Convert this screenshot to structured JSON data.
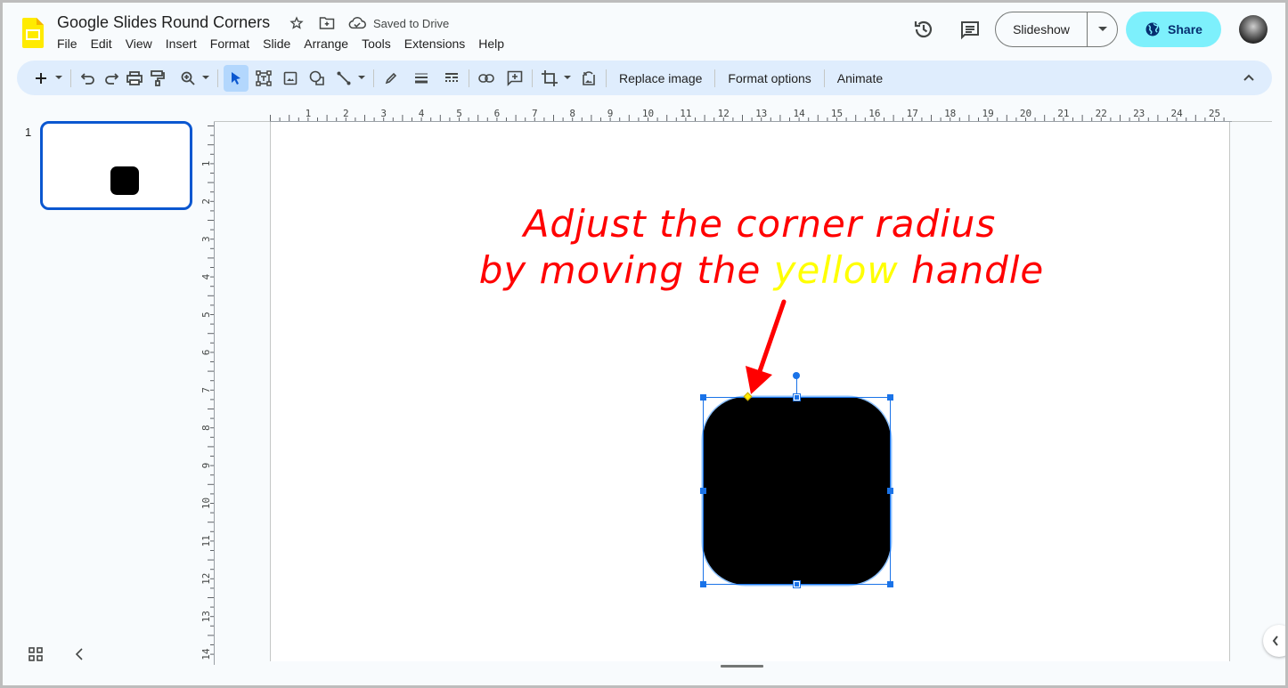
{
  "app": {
    "title": "Google Slides Round Corners",
    "save_status": "Saved to Drive",
    "brand_color": "#FFEB3B"
  },
  "menu": [
    "File",
    "Edit",
    "View",
    "Insert",
    "Format",
    "Slide",
    "Arrange",
    "Tools",
    "Extensions",
    "Help"
  ],
  "header": {
    "history_icon": "version-history-icon",
    "comments_icon": "comments-icon",
    "slideshow_label": "Slideshow",
    "share_label": "Share",
    "share_color": "#7df0fc"
  },
  "toolbar": {
    "buttons": [
      "new-slide",
      "undo",
      "redo",
      "print",
      "paint-format",
      "zoom",
      "select",
      "text-box",
      "insert-image",
      "shape",
      "line",
      "border-color",
      "border-weight",
      "border-dash",
      "insert-link",
      "add-comment",
      "crop",
      "reset-image"
    ],
    "text_buttons": [
      "Replace image",
      "Format options",
      "Animate"
    ]
  },
  "filmstrip": {
    "slides": [
      {
        "number": "1",
        "selected": true
      }
    ]
  },
  "rulers": {
    "horizontal": [
      "1",
      "2",
      "3",
      "4",
      "5",
      "6",
      "7",
      "8",
      "9",
      "10",
      "11",
      "12",
      "13",
      "14",
      "15",
      "16",
      "17",
      "18",
      "19",
      "20",
      "21",
      "22",
      "23",
      "24",
      "25"
    ],
    "vertical": [
      "1",
      "2",
      "3",
      "4",
      "5",
      "6",
      "7",
      "8",
      "9",
      "10",
      "11",
      "12",
      "13",
      "14"
    ]
  },
  "slide": {
    "annotation_line1": "Adjust the corner radius",
    "annotation_line2_a": "by moving the",
    "annotation_line2_b": "yellow",
    "annotation_line2_c": "handle",
    "annotation_color": "#ff0000",
    "highlight_color": "#ffff00",
    "shape": {
      "type": "rounded-rectangle",
      "fill": "#000000",
      "selected": true
    }
  }
}
